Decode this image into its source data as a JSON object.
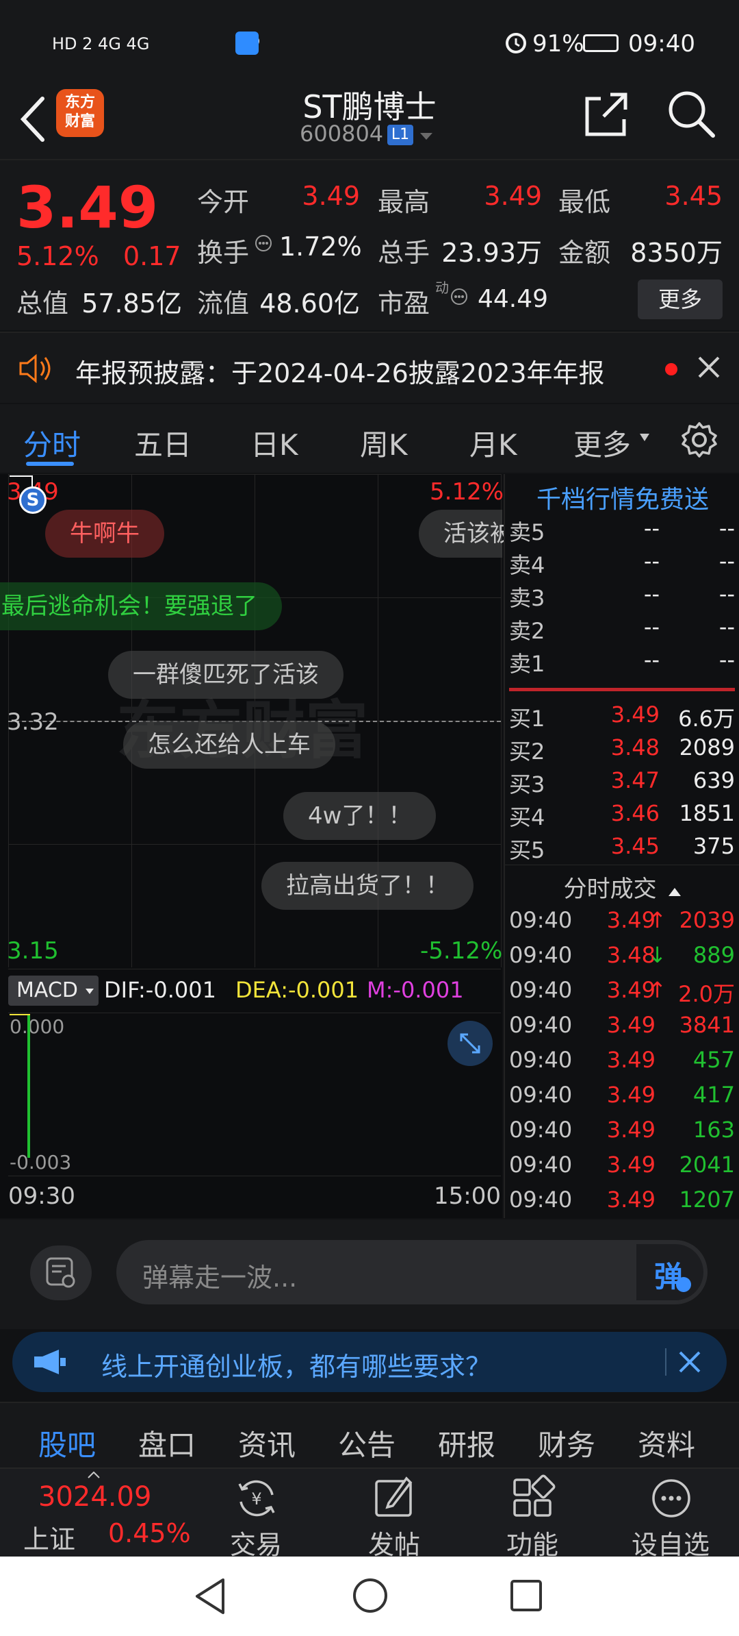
{
  "status_bar": {
    "network": "HD 2 4G 4G",
    "battery": "91%",
    "time": "09:40"
  },
  "header": {
    "logo_text_line1": "东方",
    "logo_text_line2": "财富",
    "stock_name": "ST鹏博士",
    "stock_code": "600804",
    "level_badge": "L1"
  },
  "quote": {
    "price": "3.49",
    "change_pct": "5.12%",
    "change_val": "0.17",
    "open_label": "今开",
    "open_val": "3.49",
    "high_label": "最高",
    "high_val": "3.49",
    "low_label": "最低",
    "low_val": "3.45",
    "turnover_label": "换手",
    "turnover_val": "1.72%",
    "volume_label": "总手",
    "volume_val": "23.93万",
    "amount_label": "金额",
    "amount_val": "8350万",
    "mcap_label": "总值",
    "mcap_val": "57.85亿",
    "float_label": "流值",
    "float_val": "48.60亿",
    "pe_label": "市盈",
    "pe_sup": "动",
    "pe_val": "44.49",
    "more_label": "更多"
  },
  "notice": {
    "text": "年报预披露：于2024-04-26披露2023年年报"
  },
  "tabs": [
    "分时",
    "五日",
    "日K",
    "周K",
    "月K",
    "更多"
  ],
  "chart": {
    "top_left": "3.49",
    "top_right": "5.12%",
    "mid_left": "3.32",
    "bottom_left": "3.15",
    "bottom_right": "-5.12%",
    "macd_label": "MACD",
    "dif": "DIF:-0.001",
    "dea": "DEA:-0.001",
    "m": "M:-0.001",
    "macd_top": "0.000",
    "macd_bottom": "-0.003",
    "time_start": "09:30",
    "time_end": "15:00",
    "watermark": "东方财富",
    "danmu": [
      "牛啊牛",
      "活该被",
      "最后逃命机会！要强退了",
      "一群傻匹死了活该",
      "怎么还给人上车",
      "4w了！！",
      "拉高出货了！！"
    ]
  },
  "orderbook": {
    "title": "千档行情免费送",
    "asks": [
      {
        "label": "卖5",
        "price": "--",
        "vol": "--"
      },
      {
        "label": "卖4",
        "price": "--",
        "vol": "--"
      },
      {
        "label": "卖3",
        "price": "--",
        "vol": "--"
      },
      {
        "label": "卖2",
        "price": "--",
        "vol": "--"
      },
      {
        "label": "卖1",
        "price": "--",
        "vol": "--"
      }
    ],
    "bids": [
      {
        "label": "买1",
        "price": "3.49",
        "vol": "6.6万"
      },
      {
        "label": "买2",
        "price": "3.48",
        "vol": "2089"
      },
      {
        "label": "买3",
        "price": "3.47",
        "vol": "639"
      },
      {
        "label": "买4",
        "price": "3.46",
        "vol": "1851"
      },
      {
        "label": "买5",
        "price": "3.45",
        "vol": "375"
      }
    ],
    "trades_title": "分时成交",
    "trades": [
      {
        "time": "09:40",
        "price": "3.49",
        "arrow": "↑",
        "vol": "2039",
        "color": "red"
      },
      {
        "time": "09:40",
        "price": "3.48",
        "arrow": "↓",
        "vol": "889",
        "color": "green"
      },
      {
        "time": "09:40",
        "price": "3.49",
        "arrow": "↑",
        "vol": "2.0万",
        "color": "red"
      },
      {
        "time": "09:40",
        "price": "3.49",
        "arrow": "",
        "vol": "3841",
        "color": "red"
      },
      {
        "time": "09:40",
        "price": "3.49",
        "arrow": "",
        "vol": "457",
        "color": "green"
      },
      {
        "time": "09:40",
        "price": "3.49",
        "arrow": "",
        "vol": "417",
        "color": "green"
      },
      {
        "time": "09:40",
        "price": "3.49",
        "arrow": "",
        "vol": "163",
        "color": "green"
      },
      {
        "time": "09:40",
        "price": "3.49",
        "arrow": "",
        "vol": "2041",
        "color": "green"
      },
      {
        "time": "09:40",
        "price": "3.49",
        "arrow": "",
        "vol": "1207",
        "color": "green"
      }
    ]
  },
  "danmu_bar": {
    "placeholder": "弹幕走一波...",
    "send_label": "弹"
  },
  "promo": {
    "text": "线上开通创业板，都有哪些要求？"
  },
  "subtabs": [
    "股吧",
    "盘口",
    "资讯",
    "公告",
    "研报",
    "财务",
    "资料"
  ],
  "bottom_bar": {
    "index_value": "3024.09",
    "index_name": "上证",
    "index_pct": "0.45%",
    "items": [
      "交易",
      "发帖",
      "功能",
      "设自选"
    ]
  }
}
